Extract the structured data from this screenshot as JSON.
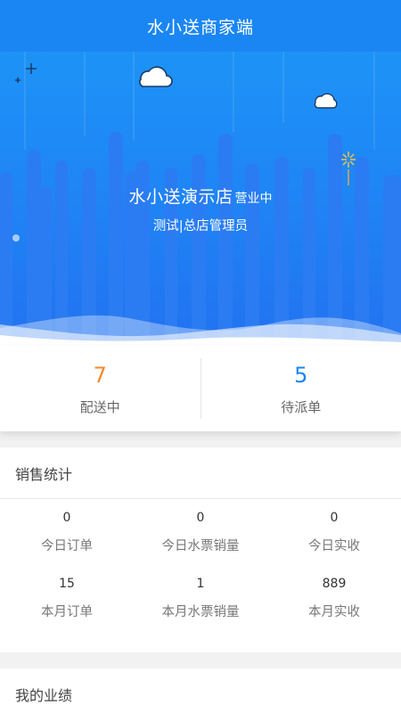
{
  "header": {
    "title": "水小送商家端"
  },
  "store": {
    "name": "水小送演示店",
    "status": "营业中",
    "role": "测试|总店管理员"
  },
  "summary": [
    {
      "value": "7",
      "label": "配送中",
      "color": "#f08a2c"
    },
    {
      "value": "5",
      "label": "待派单",
      "color": "#1a86f3"
    }
  ],
  "sales": {
    "title": "销售统计",
    "items": [
      {
        "value": "0",
        "label": "今日订单"
      },
      {
        "value": "0",
        "label": "今日水票销量"
      },
      {
        "value": "0",
        "label": "今日实收"
      },
      {
        "value": "15",
        "label": "本月订单"
      },
      {
        "value": "1",
        "label": "本月水票销量"
      },
      {
        "value": "889",
        "label": "本月实收"
      }
    ]
  },
  "performance": {
    "title": "我的业绩"
  },
  "colors": {
    "brand": "#1a86f3",
    "accent_orange": "#f08a2c",
    "hero_bottom": "#2272f0"
  },
  "icons": [
    "cloud-icon",
    "sparkle-icon",
    "firework-icon"
  ]
}
